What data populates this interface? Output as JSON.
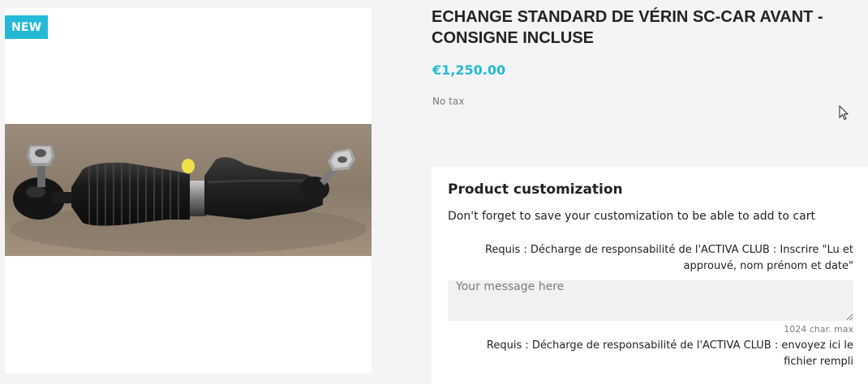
{
  "product": {
    "badge": "NEW",
    "title": "ECHANGE STANDARD DE VÉRIN SC-CAR AVANT - CONSIGNE INCLUSE",
    "price": "€1,250.00",
    "tax_label": "No tax"
  },
  "customization": {
    "title": "Product customization",
    "note": "Don't forget to save your customization to be able to add to cart",
    "field1_label": "Requis : Décharge de responsabilité de l'ACTIVA CLUB : Inscrire \"Lu et approuvé, nom prénom et date\"",
    "field1_placeholder": "Your message here",
    "field1_char_max": "1024 char. max",
    "field2_label": "Requis : Décharge de responsabilité de l'ACTIVA CLUB : envoyez ici le fichier rempli"
  },
  "colors": {
    "accent": "#24b9d7",
    "text": "#232323",
    "muted": "#7a7a7a",
    "background": "#f4f4f4"
  },
  "icons": [
    "mouse-pointer-icon"
  ]
}
